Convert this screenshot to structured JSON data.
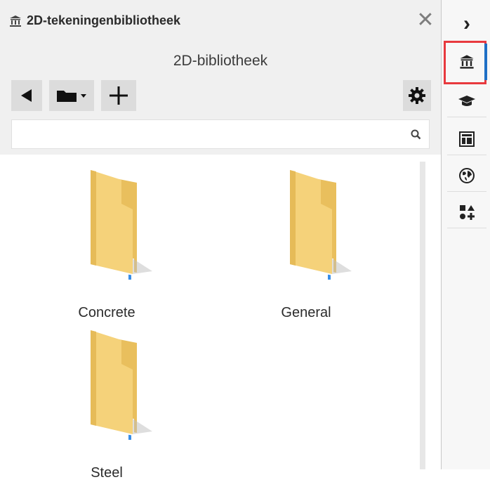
{
  "window": {
    "title": "2D-tekeningenbibliotheek",
    "close_label": "✕"
  },
  "library": {
    "heading": "2D-bibliotheek"
  },
  "search": {
    "value": "",
    "placeholder": ""
  },
  "folders": [
    {
      "name": "Concrete"
    },
    {
      "name": "General"
    },
    {
      "name": "Steel"
    }
  ],
  "sidebar": {
    "collapse_label": "›",
    "items": [
      {
        "icon": "bank-icon",
        "active": true
      },
      {
        "icon": "graduation-cap-icon",
        "active": false
      },
      {
        "icon": "layout-icon",
        "active": false
      },
      {
        "icon": "globe-icon",
        "active": false
      },
      {
        "icon": "shapes-icon",
        "active": false
      }
    ]
  },
  "colors": {
    "highlight": "#e8393e",
    "active_indicator": "#1e6fc5",
    "folder": "#f5d27a"
  }
}
